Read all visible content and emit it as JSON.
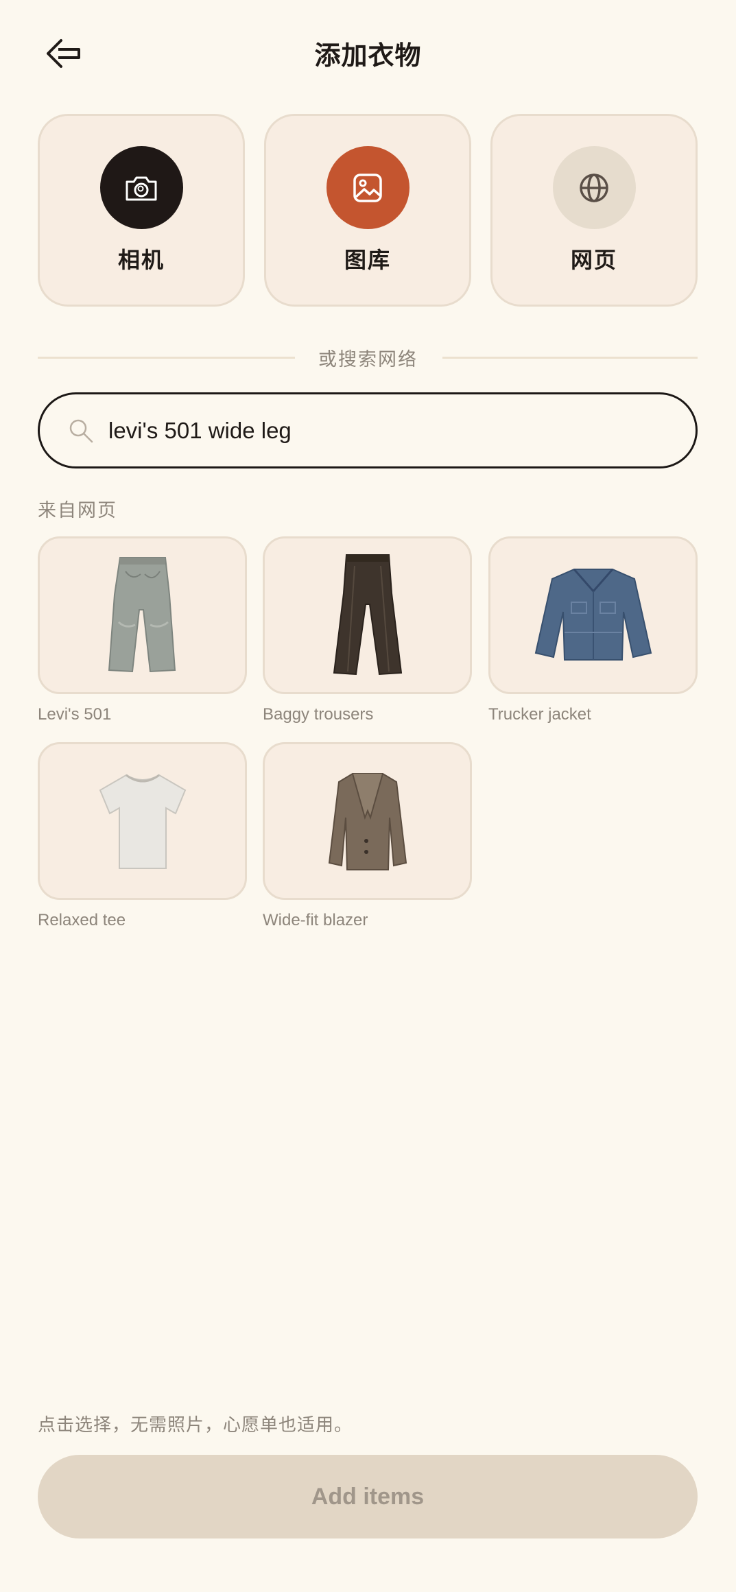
{
  "header": {
    "title": "添加衣物",
    "back_icon": "arrow-left-icon"
  },
  "sources": [
    {
      "label": "相机",
      "icon": "camera-icon",
      "color": "#1f1816"
    },
    {
      "label": "图库",
      "icon": "image-icon",
      "color": "#c4552f"
    },
    {
      "label": "网页",
      "icon": "globe-icon",
      "color": "#e6dccd"
    }
  ],
  "divider": {
    "text": "或搜索网络"
  },
  "search": {
    "value": "levi's 501 wide leg",
    "icon": "search-icon"
  },
  "results": {
    "section_label": "来自网页",
    "items": [
      {
        "caption": "Levi's 501",
        "icon": "jeans-icon"
      },
      {
        "caption": "Baggy trousers",
        "icon": "trousers-icon"
      },
      {
        "caption": "Trucker jacket",
        "icon": "jacket-icon"
      },
      {
        "caption": "Relaxed tee",
        "icon": "tshirt-icon"
      },
      {
        "caption": "Wide-fit blazer",
        "icon": "blazer-icon"
      }
    ]
  },
  "footer": {
    "hint": "点击选择，无需照片，心愿单也适用。",
    "add_button_label": "Add items"
  }
}
